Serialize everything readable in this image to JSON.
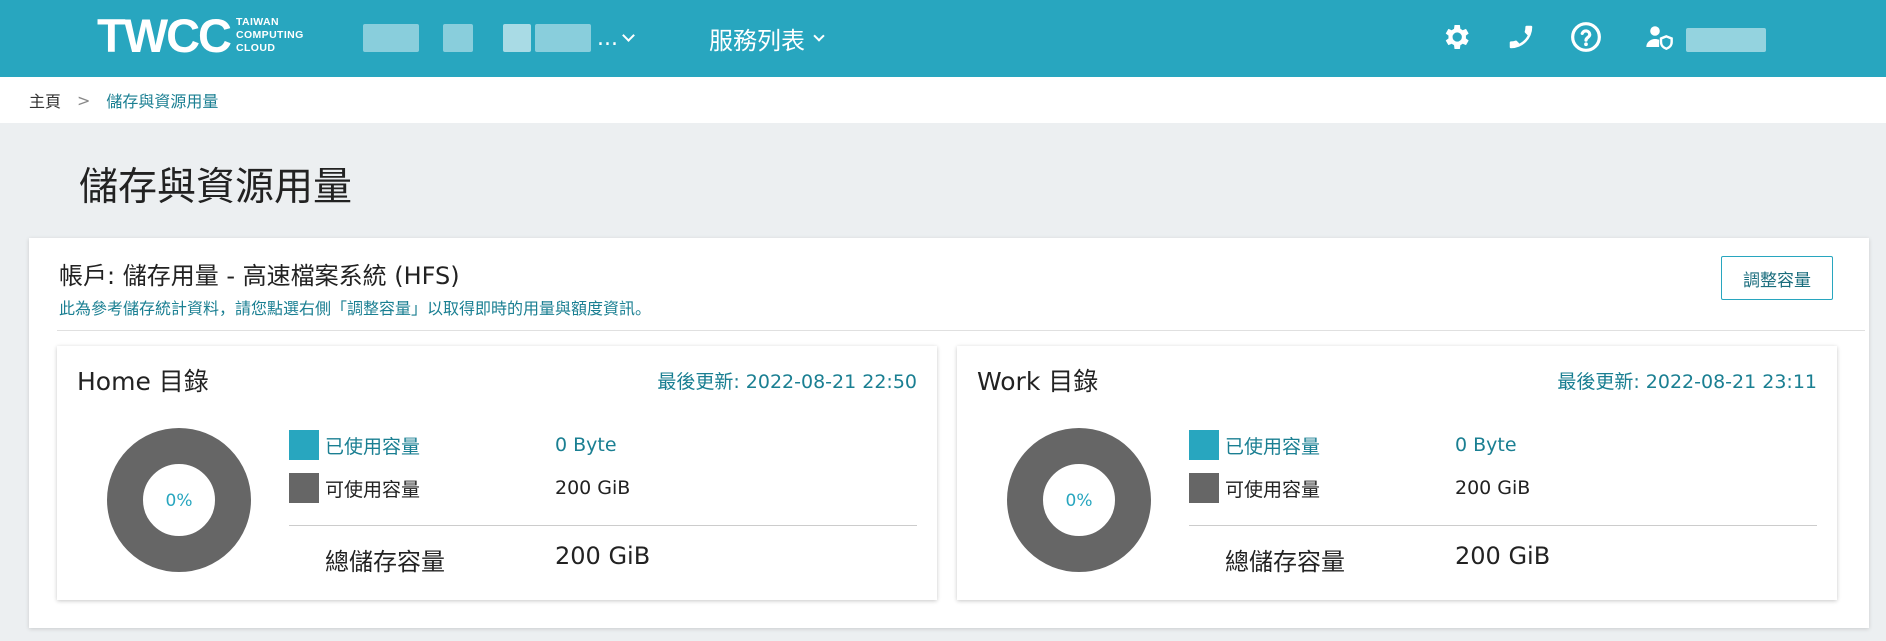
{
  "header": {
    "logo_mark": "TWCC",
    "logo_sub": [
      "TAIWAN",
      "COMPUTING",
      "CLOUD"
    ],
    "project_ellipsis": "...",
    "services_label": "服務列表",
    "icons": [
      "gear-icon",
      "phone-icon",
      "help-icon",
      "user-shield-icon"
    ],
    "accent_color": "#28a6bf"
  },
  "breadcrumb": {
    "home": "主頁",
    "separator": ">",
    "current": "儲存與資源用量"
  },
  "page": {
    "title": "儲存與資源用量"
  },
  "card": {
    "title": "帳戶: 儲存用量 - 高速檔案系統 (HFS)",
    "note": "此為參考儲存統計資料，請您點選右側「調整容量」以取得即時的用量與額度資訊。",
    "adjust_button": "調整容量"
  },
  "panels": [
    {
      "title": "Home 目錄",
      "updated": "最後更新: 2022-08-21 22:50",
      "percent_label": "0%",
      "used_fraction": 0,
      "used_label": "已使用容量",
      "used_value": "0 Byte",
      "free_label": "可使用容量",
      "free_value": "200 GiB",
      "total_label": "總儲存容量",
      "total_value": "200 GiB"
    },
    {
      "title": "Work 目錄",
      "updated": "最後更新: 2022-08-21 23:11",
      "percent_label": "0%",
      "used_fraction": 0,
      "used_label": "已使用容量",
      "used_value": "0 Byte",
      "free_label": "可使用容量",
      "free_value": "200 GiB",
      "total_label": "總儲存容量",
      "total_value": "200 GiB"
    }
  ],
  "colors": {
    "used": "#28a6bf",
    "free": "#666666"
  }
}
